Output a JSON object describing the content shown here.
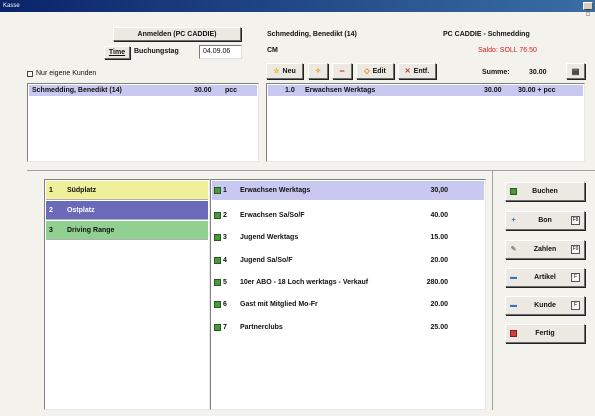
{
  "window": {
    "title": "Kasse",
    "control": "_ □"
  },
  "header": {
    "login_button": "Anmelden (PC CADDIE)",
    "time_button": "Time",
    "buchungstag_label": "Buchungstag",
    "buchungstag_value": "04.09.06",
    "customer_name": "Schmedding, Benedikt (14)",
    "customer_code": "CM",
    "app_title": "PC CADDIE - Schmedding",
    "saldo": "Saldo: SOLL 76.50",
    "own_customers_checkbox": "Nur eigene Kunden"
  },
  "toolbar": {
    "new_label": "Neu",
    "edit_label": "Edit",
    "delete_label": "Entf.",
    "summe_label": "Summe:",
    "summe_value": "30.00",
    "calculator_icon": "calculator-icon"
  },
  "customer_list": [
    {
      "name": "Schmedding, Benedikt (14)",
      "amount": "30.00",
      "unit": "pcc"
    }
  ],
  "booking_lines": [
    {
      "qty": "1.0",
      "item": "Erwachsen Werktags",
      "price": "30.00",
      "total": "30.00 + pcc"
    }
  ],
  "categories": [
    {
      "idx": "1",
      "label": "Südplatz",
      "color": "#f0f09a"
    },
    {
      "idx": "2",
      "label": "Ostplatz",
      "color": "#6a6ab8"
    },
    {
      "idx": "3",
      "label": "Driving Range",
      "color": "#90d090"
    }
  ],
  "products": [
    {
      "idx": "1",
      "name": "Erwachsen Werktags",
      "price": "30,00"
    },
    {
      "idx": "2",
      "name": "Erwachsen Sa/So/F",
      "price": "40.00"
    },
    {
      "idx": "3",
      "name": "Jugend Werktags",
      "price": "15.00"
    },
    {
      "idx": "4",
      "name": "Jugend Sa/So/F",
      "price": "20.00"
    },
    {
      "idx": "5",
      "name": "10er ABO - 18 Loch werktags - Verkauf",
      "price": "280.00"
    },
    {
      "idx": "6",
      "name": "Gast mit Mitglied Mo-Fr",
      "price": "20.00"
    },
    {
      "idx": "7",
      "name": "Partnerclubs",
      "price": "25.00"
    }
  ],
  "actions": {
    "buchen": "Buchen",
    "bon": "Bon",
    "bon_key": "F8",
    "zahlen": "Zahlen",
    "zahlen_key": "F9",
    "artikel": "Artikel",
    "artikel_key": "F",
    "kunde": "Kunde",
    "kunde_key": "F",
    "fertig": "Fertig"
  },
  "colors": {
    "selected_row": "#c8c8f0",
    "product_icon": "#4a9a3a",
    "delete_red": "#c0392b",
    "saldo_red": "#d02020"
  }
}
